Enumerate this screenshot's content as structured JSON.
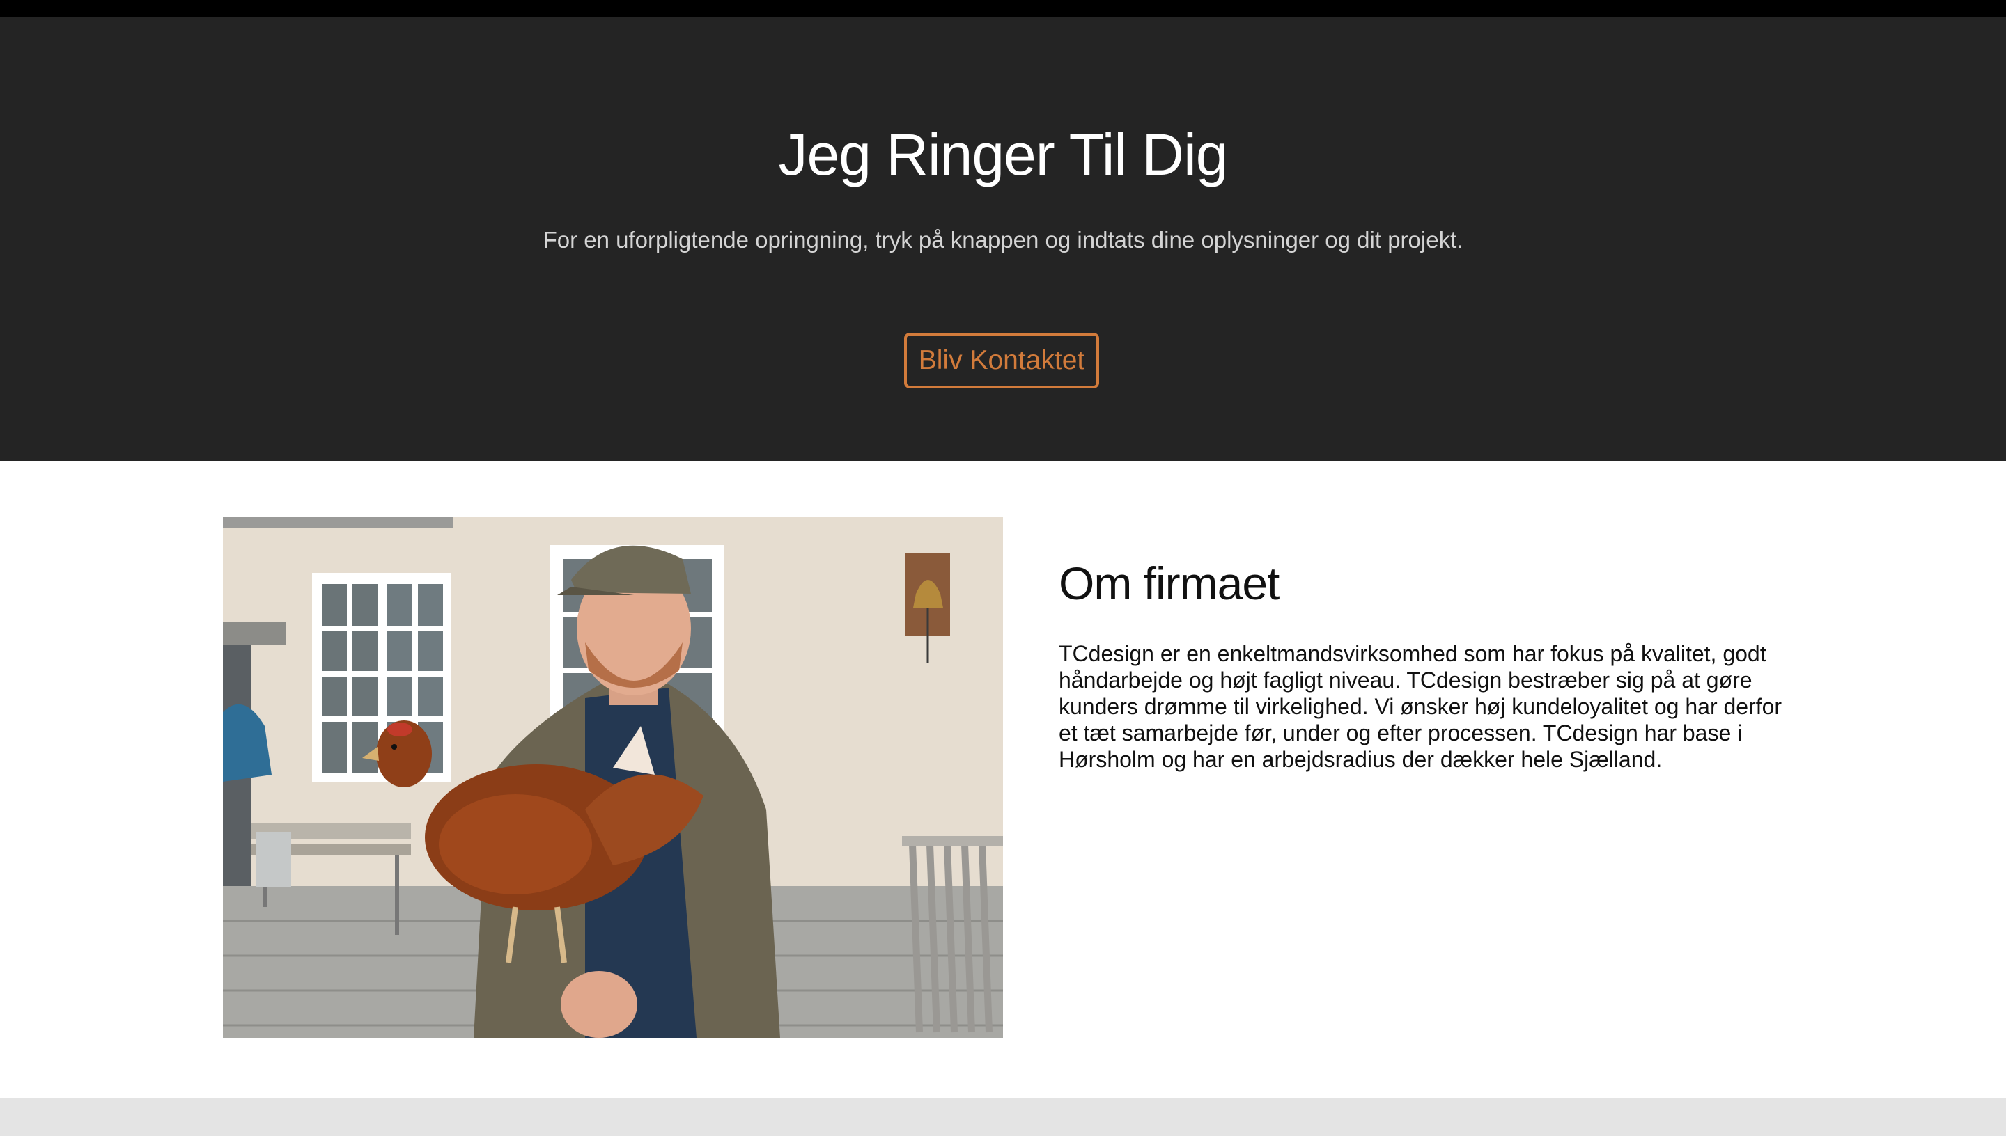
{
  "hero": {
    "title": "Jeg Ringer Til Dig",
    "subtitle": "For en uforpligtende opringning, tryk på knappen og indtats dine oplysninger og dit projekt.",
    "button_label": "Bliv Kontaktet"
  },
  "about": {
    "title": "Om firmaet",
    "text": "TCdesign er en enkeltmandsvirksomhed som har fokus på kvalitet, godt håndarbejde og højt fagligt niveau. TCdesign bestræber sig på at gøre kunders drømme til virkelighed. Vi ønsker høj kundeloyalitet og har derfor et tæt samarbejde før, under og efter processen. TCdesign har base i Hørsholm og har en arbejdsradius der dækker hele Sjælland."
  },
  "colors": {
    "hero_bg": "#242424",
    "accent": "#d27b3b",
    "footer_bg": "#e4e4e4"
  }
}
